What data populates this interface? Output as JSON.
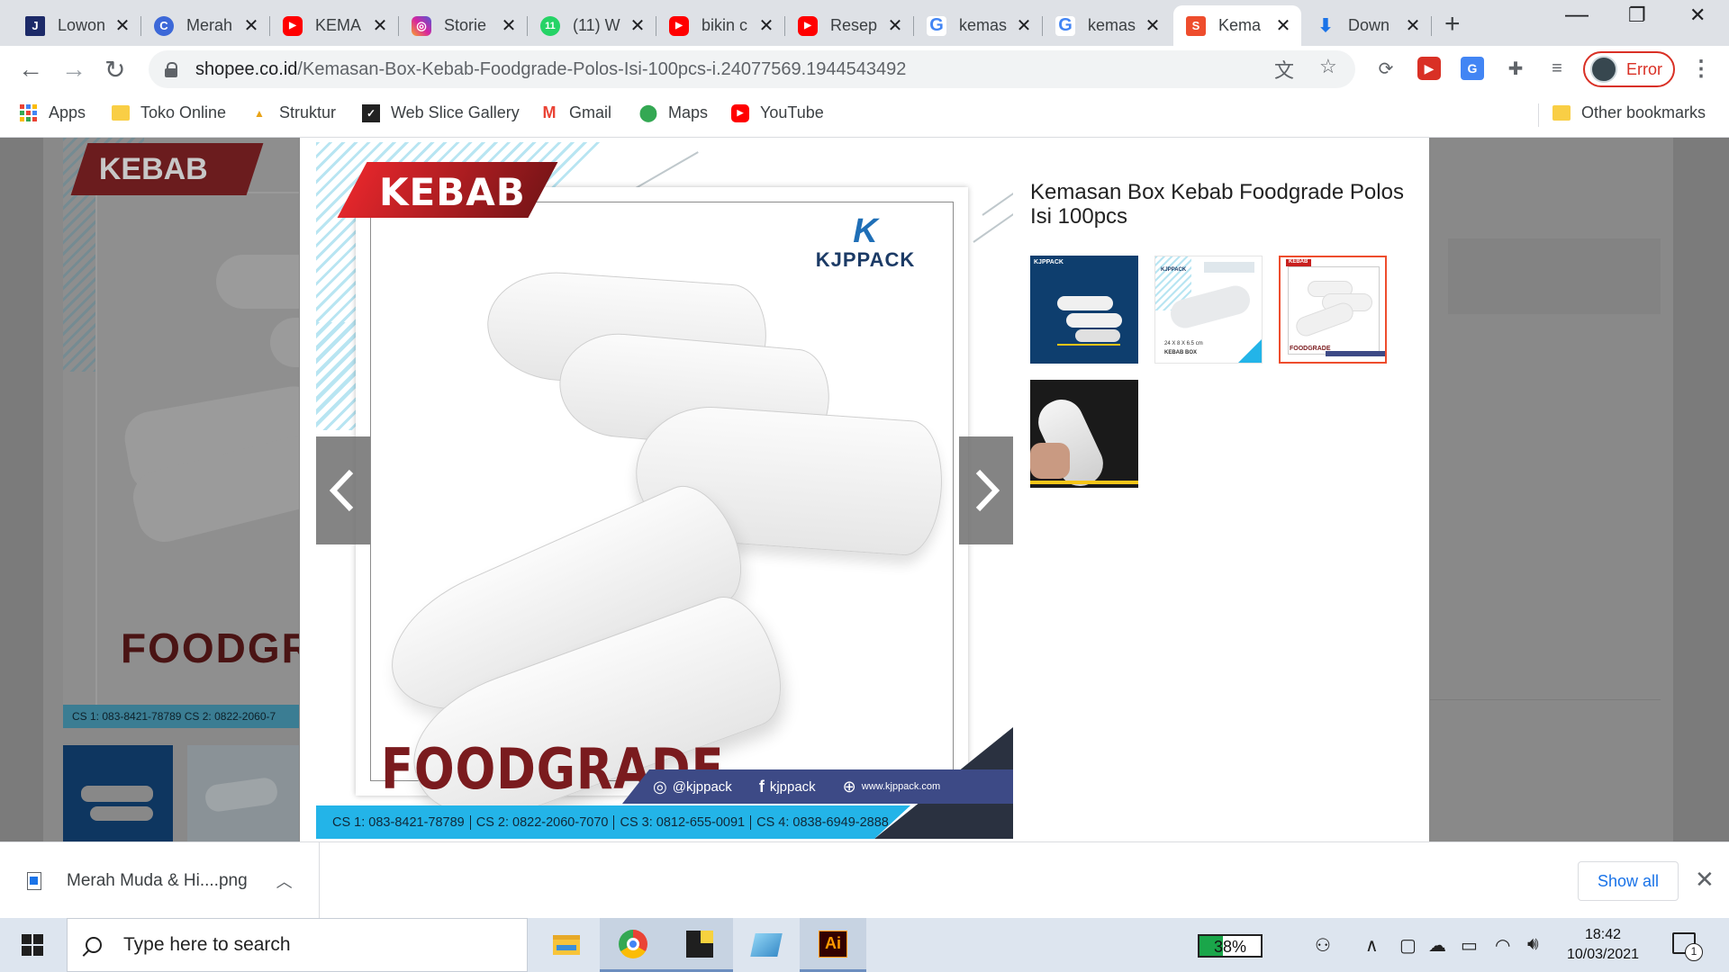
{
  "tabs": [
    {
      "title": "Lowon",
      "icon": "jobstreet-icon",
      "color": "#1c2a68",
      "letter": "J"
    },
    {
      "title": "Merah",
      "icon": "canva-icon",
      "color": "#3c68d8",
      "letter": "C"
    },
    {
      "title": "KEMA",
      "icon": "youtube-icon",
      "color": "#ff0000",
      "letter": "▶"
    },
    {
      "title": "Storie",
      "icon": "instagram-icon",
      "color": "#d6249f",
      "letter": "◎"
    },
    {
      "title": "(11) W",
      "icon": "whatsapp-icon",
      "color": "#25d366",
      "letter": "11"
    },
    {
      "title": "bikin c",
      "icon": "youtube-icon",
      "color": "#ff0000",
      "letter": "▶"
    },
    {
      "title": "Resep",
      "icon": "youtube-icon",
      "color": "#ff0000",
      "letter": "▶"
    },
    {
      "title": "kemas",
      "icon": "google-icon",
      "color": "#4285f4",
      "letter": "G"
    },
    {
      "title": "kemas",
      "icon": "google-icon",
      "color": "#4285f4",
      "letter": "G"
    },
    {
      "title": "Kema",
      "icon": "shopee-icon",
      "color": "#ee4d2d",
      "letter": "S",
      "active": true
    },
    {
      "title": "Down",
      "icon": "download-icon",
      "color": "#1a73e8",
      "letter": "⬇"
    }
  ],
  "address": {
    "domain": "shopee.co.id",
    "path": "/Kemasan-Box-Kebab-Foodgrade-Polos-Isi-100pcs-i.24077569.1944543492"
  },
  "profile": {
    "label": "Error"
  },
  "bookmarks": [
    {
      "label": "Apps",
      "icon": "apps-grid-icon"
    },
    {
      "label": "Toko Online",
      "icon": "folder-icon"
    },
    {
      "label": "Struktur",
      "icon": "pma-icon"
    },
    {
      "label": "Web Slice Gallery",
      "icon": "web-slice-icon"
    },
    {
      "label": "Gmail",
      "icon": "gmail-icon"
    },
    {
      "label": "Maps",
      "icon": "maps-icon"
    },
    {
      "label": "YouTube",
      "icon": "youtube-icon"
    }
  ],
  "other_bookmarks": "Other bookmarks",
  "product": {
    "title": "Kemasan Box Kebab Foodgrade Polos Isi 100pcs",
    "image": {
      "banner": "KEBAB",
      "brand": "KJPPACK",
      "brand_mark": "K",
      "headline": "FOODGRADE",
      "social": [
        {
          "icon": "instagram-icon",
          "glyph": "◎",
          "text": "@kjppack"
        },
        {
          "icon": "facebook-icon",
          "glyph": "f",
          "text": "kjppack"
        },
        {
          "icon": "globe-icon",
          "glyph": "⊕",
          "text": "www.kjppack.com"
        }
      ],
      "contacts": [
        "CS 1: 083-8421-78789",
        "CS 2: 0822-2060-7070",
        "CS 3: 0812-655-0091",
        "CS 4: 0838-6949-2888"
      ]
    },
    "thumbnails": [
      {
        "label": "",
        "caption": ""
      },
      {
        "label": "KEBAB BOX",
        "caption": "24 X 8 X 6.5 cm"
      },
      {
        "label": "FOODGRADE",
        "caption": "KEBAB"
      },
      {
        "label": "",
        "caption": ""
      }
    ],
    "selected_thumbnail": 3
  },
  "background": {
    "banner": "KEBAB",
    "headline": "FOODGRAD",
    "contacts": "CS 1: 083-8421-78789   CS 2: 0822-2060-7"
  },
  "download": {
    "file": "Merah Muda & Hi....png",
    "show_all": "Show all"
  },
  "taskbar": {
    "search_placeholder": "Type here to search",
    "apps": [
      {
        "name": "file-explorer-icon"
      },
      {
        "name": "chrome-icon",
        "active": true
      },
      {
        "name": "sticky-notes-icon"
      },
      {
        "name": "paint-3d-icon"
      },
      {
        "name": "illustrator-icon",
        "label": "Ai"
      }
    ],
    "battery": {
      "percent": 38,
      "label": "38%"
    },
    "time": "18:42",
    "date": "10/03/2021",
    "notifications": "1"
  }
}
